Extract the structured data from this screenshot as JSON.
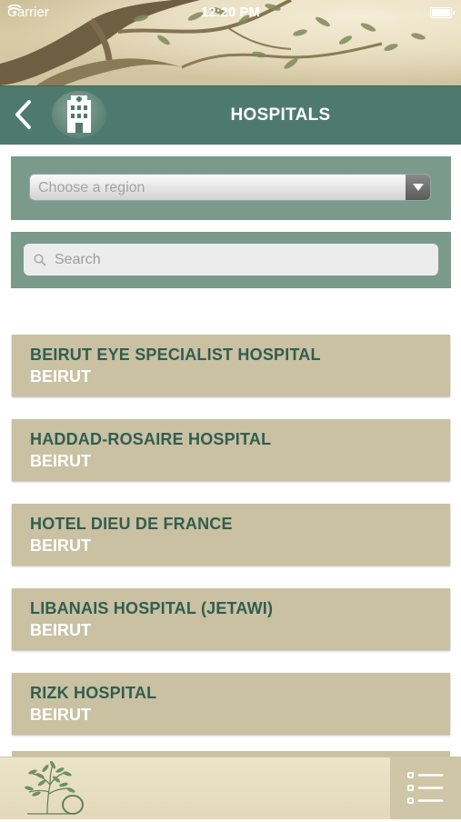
{
  "status_bar": {
    "carrier": "Carrier",
    "time": "12:20 PM"
  },
  "header": {
    "title": "HOSPITALS",
    "back_icon": "chevron-left-icon",
    "badge_icon": "hospital-building-icon"
  },
  "region": {
    "placeholder": "Choose a region",
    "arrow_icon": "triangle-down-icon"
  },
  "search": {
    "placeholder": "Search",
    "value": ""
  },
  "hospitals": [
    {
      "name": "BEIRUT EYE SPECIALIST HOSPITAL",
      "city": "BEIRUT"
    },
    {
      "name": "HADDAD-ROSAIRE HOSPITAL",
      "city": "BEIRUT"
    },
    {
      "name": "HOTEL DIEU DE FRANCE",
      "city": "BEIRUT"
    },
    {
      "name": "LIBANAIS HOSPITAL (JETAWI)",
      "city": "BEIRUT"
    },
    {
      "name": "RIZK HOSPITAL",
      "city": "BEIRUT"
    }
  ],
  "bottom_bar": {
    "logo_icon": "olive-tree-logo-icon",
    "menu_icon": "list-menu-icon"
  },
  "colors": {
    "title_bar": "#4e7a6d",
    "panel": "#7a9a8c",
    "card": "#c9c1a2",
    "card_title": "#315d50",
    "bottom_bar": "#e3d9b9"
  }
}
